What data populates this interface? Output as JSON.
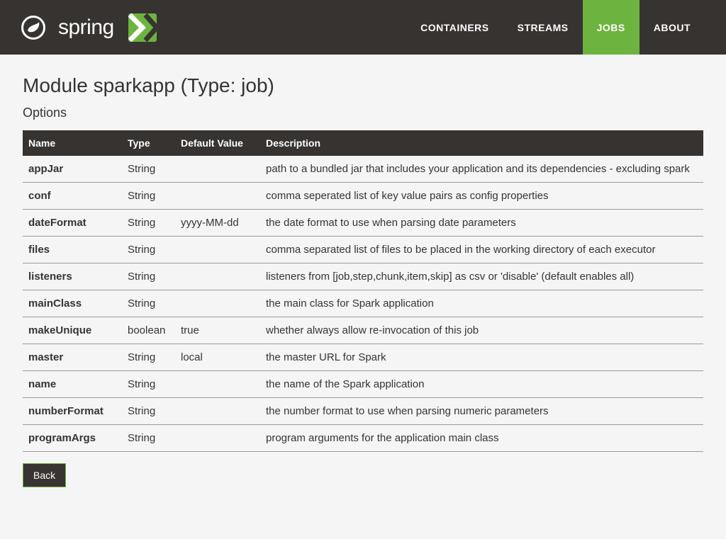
{
  "brand": {
    "text": "spring"
  },
  "nav": {
    "items": [
      {
        "label": "CONTAINERS",
        "active": false
      },
      {
        "label": "STREAMS",
        "active": false
      },
      {
        "label": "JOBS",
        "active": true
      },
      {
        "label": "ABOUT",
        "active": false
      }
    ]
  },
  "page": {
    "title": "Module sparkapp (Type: job)",
    "section": "Options"
  },
  "table": {
    "headers": {
      "name": "Name",
      "type": "Type",
      "default": "Default Value",
      "description": "Description"
    },
    "rows": [
      {
        "name": "appJar",
        "type": "String",
        "default": "",
        "description": "path to a bundled jar that includes your application and its dependencies - excluding spark"
      },
      {
        "name": "conf",
        "type": "String",
        "default": "",
        "description": "comma seperated list of key value pairs as config properties"
      },
      {
        "name": "dateFormat",
        "type": "String",
        "default": "yyyy-MM-dd",
        "description": "the date format to use when parsing date parameters"
      },
      {
        "name": "files",
        "type": "String",
        "default": "",
        "description": "comma separated list of files to be placed in the working directory of each executor"
      },
      {
        "name": "listeners",
        "type": "String",
        "default": "",
        "description": "listeners from [job,step,chunk,item,skip] as csv or 'disable' (default enables all)"
      },
      {
        "name": "mainClass",
        "type": "String",
        "default": "",
        "description": "the main class for Spark application"
      },
      {
        "name": "makeUnique",
        "type": "boolean",
        "default": "true",
        "description": "whether always allow re-invocation of this job"
      },
      {
        "name": "master",
        "type": "String",
        "default": "local",
        "description": "the master URL for Spark"
      },
      {
        "name": "name",
        "type": "String",
        "default": "",
        "description": "the name of the Spark application"
      },
      {
        "name": "numberFormat",
        "type": "String",
        "default": "",
        "description": "the number format to use when parsing numeric parameters"
      },
      {
        "name": "programArgs",
        "type": "String",
        "default": "",
        "description": "program arguments for the application main class"
      }
    ]
  },
  "buttons": {
    "back": "Back"
  },
  "colors": {
    "accent": "#6db33f",
    "header": "#363331"
  }
}
